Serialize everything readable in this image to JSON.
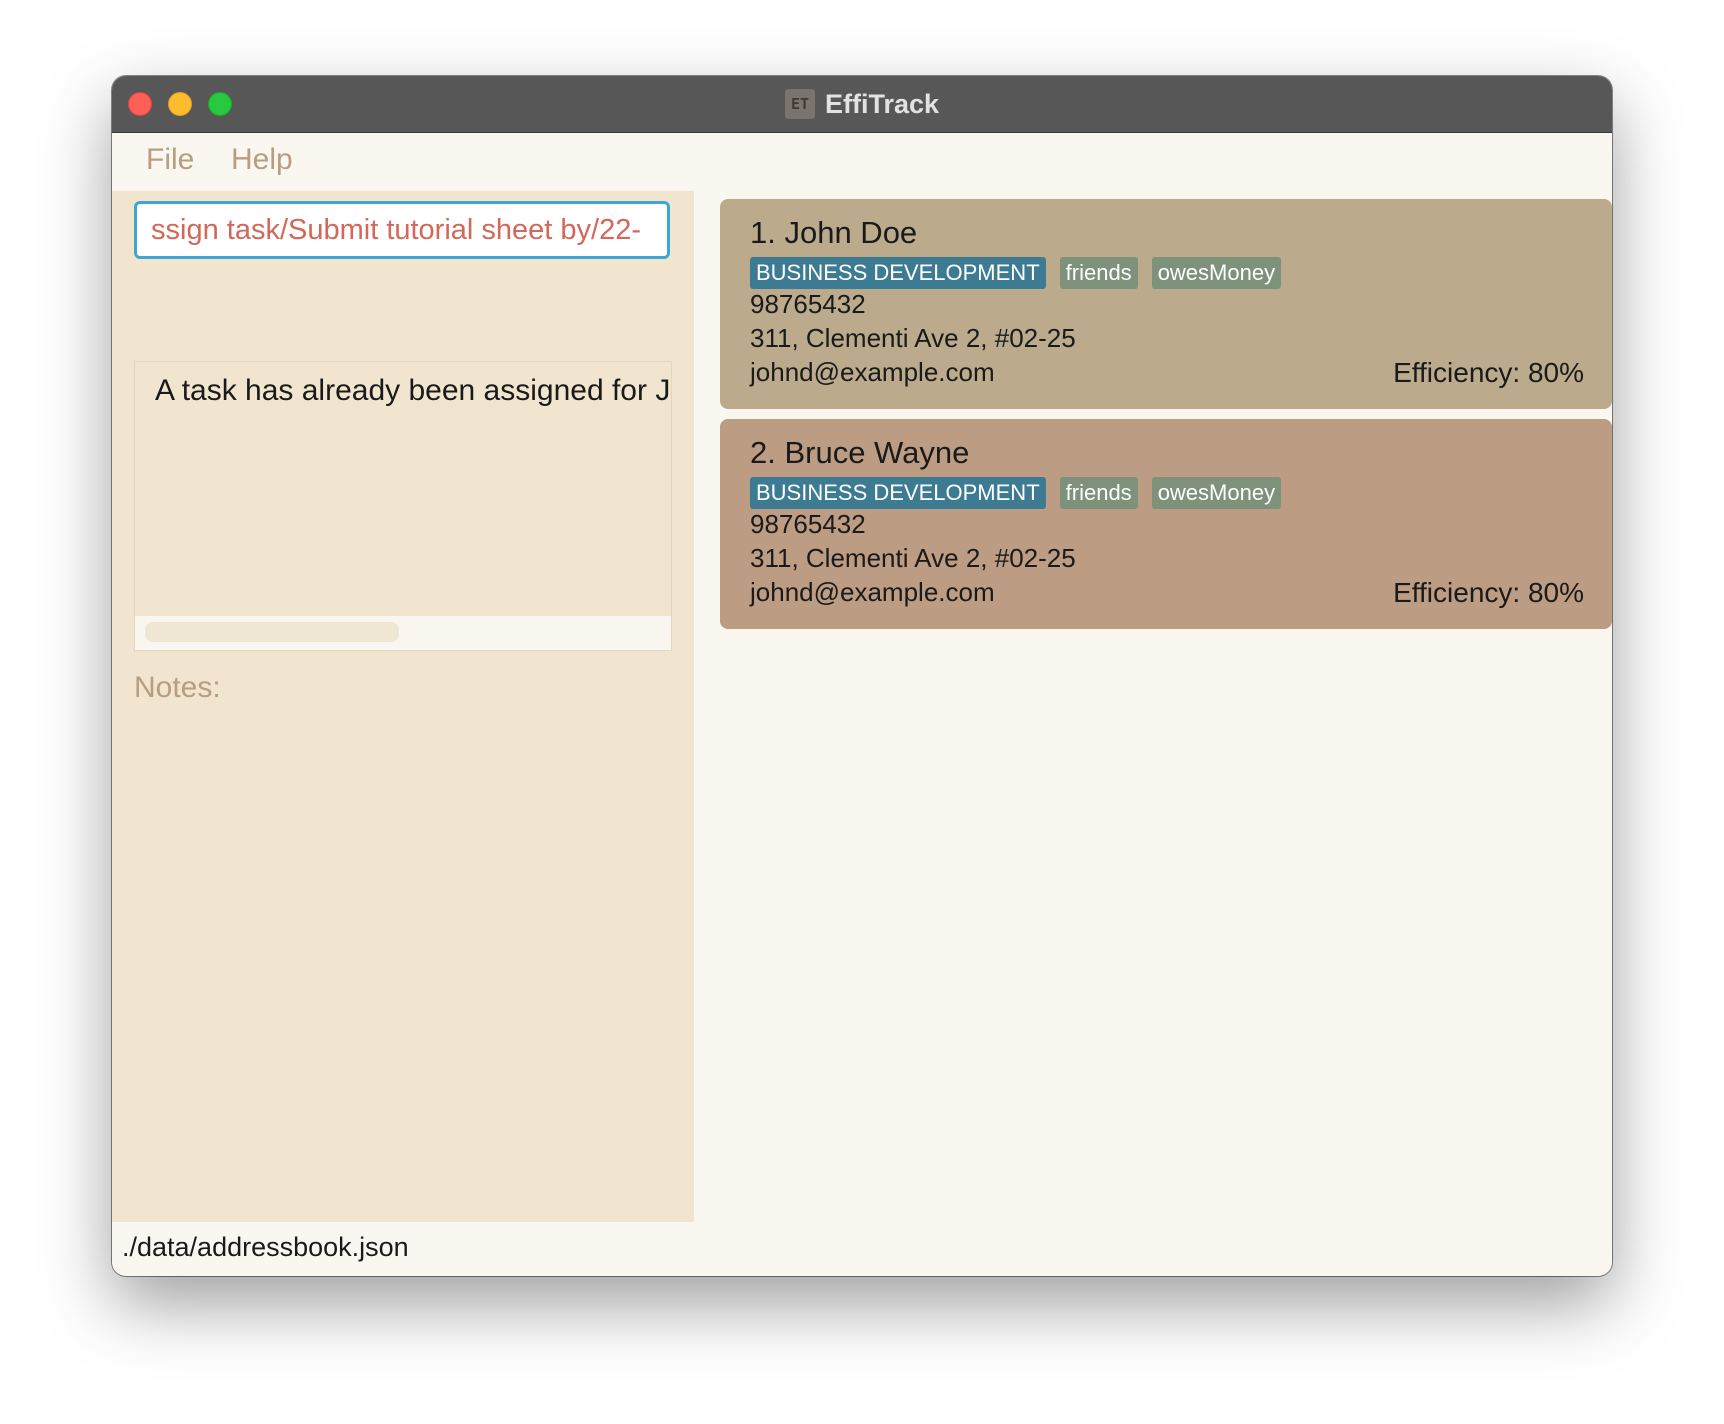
{
  "window": {
    "title": "EffiTrack",
    "app_icon_glyph": "ET"
  },
  "menu": {
    "file": "File",
    "help": "Help"
  },
  "command": {
    "value": "ssign task/Submit tutorial sheet by/22-"
  },
  "result": {
    "message": "A task has already been assigned for Jo"
  },
  "notes": {
    "label": "Notes:"
  },
  "persons": [
    {
      "name": "1.  John Doe",
      "tags": [
        "BUSINESS DEVELOPMENT",
        "friends",
        "owesMoney"
      ],
      "phone": "98765432",
      "address": "311, Clementi Ave 2, #02-25",
      "email": "johnd@example.com",
      "efficiency": "Efficiency: 80%"
    },
    {
      "name": "2.  Bruce Wayne",
      "tags": [
        "BUSINESS DEVELOPMENT",
        "friends",
        "owesMoney"
      ],
      "phone": "98765432",
      "address": "311, Clementi Ave 2, #02-25",
      "email": "johnd@example.com",
      "efficiency": "Efficiency: 80%"
    }
  ],
  "status": {
    "path": "./data/addressbook.json"
  },
  "colors": {
    "title_bar": "#575757",
    "panel_bg": "#f1e5cf",
    "command_border": "#3ea6d3",
    "command_text": "#d1685a",
    "card_1": "#bbab8c",
    "card_2": "#bc9c82",
    "department_tag": "#3d7b93",
    "plain_tag": "#7e917b"
  }
}
